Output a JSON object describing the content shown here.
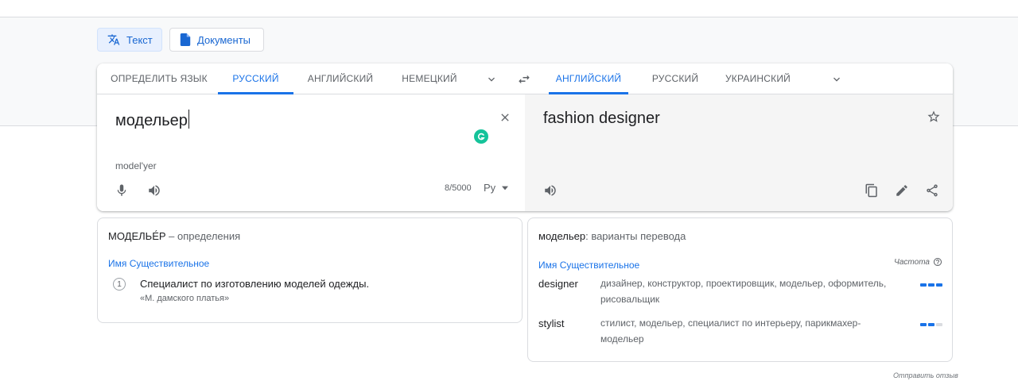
{
  "modes": {
    "text": "Текст",
    "docs": "Документы"
  },
  "source_langs": {
    "detect": "ОПРЕДЕЛИТЬ ЯЗЫК",
    "l1": "РУССКИЙ",
    "l2": "АНГЛИЙСКИЙ",
    "l3": "НЕМЕЦКИЙ",
    "active": "РУССКИЙ"
  },
  "target_langs": {
    "l1": "АНГЛИЙСКИЙ",
    "l2": "РУССКИЙ",
    "l3": "УКРАИНСКИЙ",
    "active": "АНГЛИЙСКИЙ"
  },
  "source": {
    "text": "модельер",
    "transliteration": "model'yer",
    "counter": "8/5000",
    "keyboard": "Ру"
  },
  "target": {
    "text": "fashion designer"
  },
  "definitions": {
    "headword": "МОДЕЛЬЕ́Р",
    "title_suffix": " – определения",
    "pos": "Имя Существительное",
    "items": [
      {
        "number": "1",
        "text": "Специалист по изготовлению моделей одежды.",
        "example": "«М. дамского платья»"
      }
    ]
  },
  "alternatives": {
    "headword": "модельер",
    "title_suffix": ": варианты перевода",
    "pos": "Имя Существительное",
    "frequency_label": "Частота",
    "rows": [
      {
        "word": "designer",
        "synonyms": "дизайнер, конструктор, проектировщик, модельер, оформитель, рисовальщик",
        "frequency": 3
      },
      {
        "word": "stylist",
        "synonyms": "стилист, модельер, специалист по интерьеру, парикмахер-модельер",
        "frequency": 2
      }
    ]
  },
  "footer": {
    "feedback": "Отправить отзыв"
  },
  "colors": {
    "accent": "#1a73e8",
    "grammarly": "#15c39a"
  }
}
